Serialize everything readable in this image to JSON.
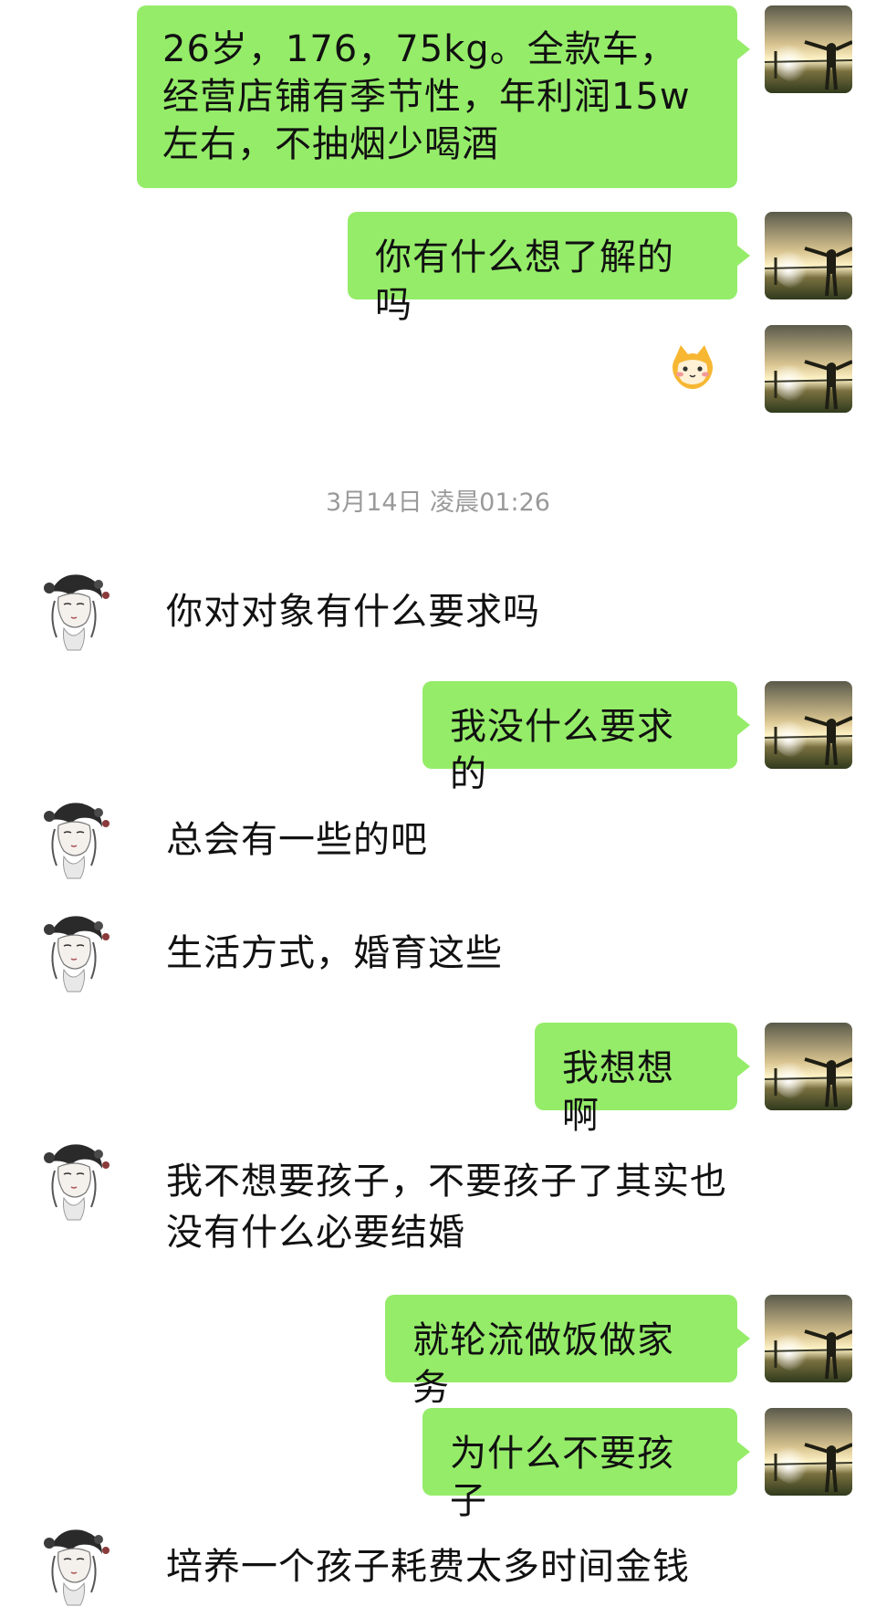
{
  "messages": [
    {
      "side": "me",
      "type": "text",
      "text": "26岁，176，75kg。全款车，经营店铺有季节性，年利润15w左右，不抽烟少喝酒"
    },
    {
      "side": "me",
      "type": "text",
      "text": "你有什么想了解的吗"
    },
    {
      "side": "me",
      "type": "sticker",
      "icon": "cat-emoji-icon"
    },
    {
      "side": "system",
      "type": "timestamp",
      "text": "3月14日 凌晨01:26"
    },
    {
      "side": "them",
      "type": "text",
      "text": "你对对象有什么要求吗"
    },
    {
      "side": "me",
      "type": "text",
      "text": "我没什么要求的"
    },
    {
      "side": "them",
      "type": "text",
      "text": "总会有一些的吧"
    },
    {
      "side": "them",
      "type": "text",
      "text": "生活方式，婚育这些"
    },
    {
      "side": "me",
      "type": "text",
      "text": "我想想啊"
    },
    {
      "side": "them",
      "type": "text",
      "text": "我不想要孩子，不要孩子了其实也没有什么必要结婚"
    },
    {
      "side": "me",
      "type": "text",
      "text": "就轮流做饭做家务"
    },
    {
      "side": "me",
      "type": "text",
      "text": "为什么不要孩子"
    },
    {
      "side": "them",
      "type": "text",
      "text": "培养一个孩子耗费太多时间金钱"
    }
  ],
  "colors": {
    "my_bubble": "#95ec69",
    "timestamp_text": "#9a9a9a",
    "background": "#ffffff"
  }
}
